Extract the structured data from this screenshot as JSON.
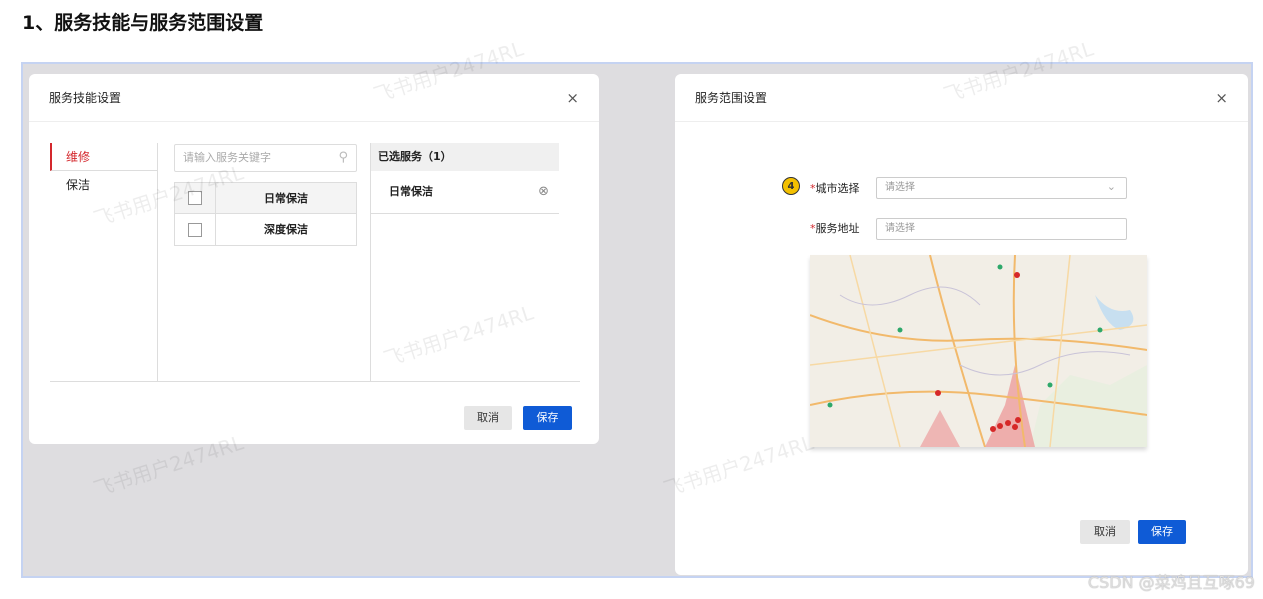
{
  "page": {
    "heading": "1、服务技能与服务范围设置"
  },
  "skill_dialog": {
    "title": "服务技能设置",
    "close": "×",
    "categories": [
      "维修",
      "保洁"
    ],
    "search_placeholder": "请输入服务关键字",
    "services": [
      "日常保洁",
      "深度保洁"
    ],
    "selected_header": "已选服务（1）",
    "selected_items": [
      "日常保洁"
    ],
    "cancel": "取消",
    "save": "保存"
  },
  "range_dialog": {
    "title": "服务范围设置",
    "close": "×",
    "step_badge": "4",
    "city_label": "城市选择",
    "city_placeholder": "请选择",
    "address_label": "服务地址",
    "address_placeholder": "请选择",
    "cancel": "取消",
    "save": "保存"
  },
  "watermark": "飞书用户2474RL",
  "credit": "CSDN @菜鸡且互啄69",
  "colors": {
    "accent_red": "#d4282d",
    "primary_blue": "#0f5bd6",
    "badge_yellow": "#f3c000"
  },
  "icons": {
    "search": "search-icon",
    "remove": "remove-circle-icon",
    "chevron": "chevron-down-icon",
    "close": "close-icon"
  }
}
